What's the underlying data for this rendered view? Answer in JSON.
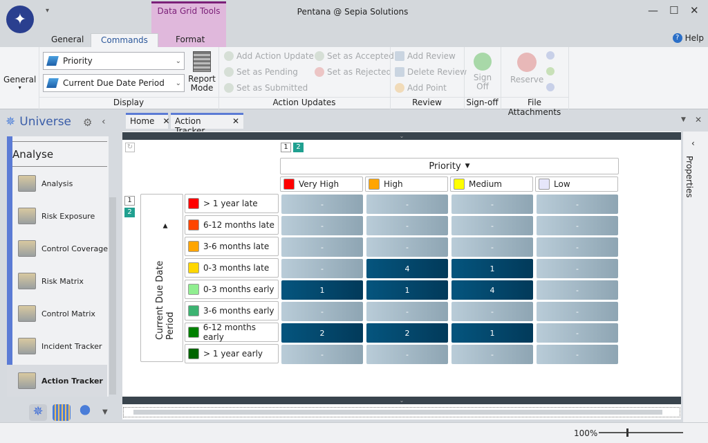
{
  "window": {
    "title": "Pentana @ Sepia Solutions",
    "context_tab_group": "Data Grid Tools",
    "minimize": "—",
    "maximize": "☐",
    "close": "✕"
  },
  "ribbon_tabs": [
    "General",
    "Commands",
    "Format"
  ],
  "help": "Help",
  "ribbon": {
    "general": "General",
    "display": {
      "combo1": "Priority",
      "combo2": "Current Due Date Period",
      "report_mode": "Report Mode",
      "label": "Display"
    },
    "action_updates": {
      "items": [
        "Add Action Update",
        "Set as Pending",
        "Set as Submitted",
        "Set as Accepted",
        "Set as Rejected"
      ],
      "label": "Action Updates"
    },
    "review": {
      "items": [
        "Add Review",
        "Delete Review",
        "Add Point"
      ],
      "label": "Review"
    },
    "signoff": {
      "button": "Sign Off",
      "label": "Sign-off"
    },
    "attachments": {
      "button": "Reserve",
      "label": "File Attachments"
    }
  },
  "sidebar": {
    "title": "Universe",
    "section": "Analyse",
    "items": [
      "Analysis",
      "Risk Exposure",
      "Control Coverage",
      "Risk Matrix",
      "Control Matrix",
      "Incident Tracker",
      "Action Tracker"
    ],
    "active": "Action Tracker"
  },
  "doc_tabs": [
    "Home",
    "Action Tracker"
  ],
  "properties": "Properties",
  "grid": {
    "levels": [
      "1",
      "2"
    ],
    "column_header": "Priority",
    "row_header": "Current Due Date Period",
    "columns": [
      {
        "label": "Very High",
        "color": "#ff0000"
      },
      {
        "label": "High",
        "color": "#ffa500"
      },
      {
        "label": "Medium",
        "color": "#ffff00"
      },
      {
        "label": "Low",
        "color": "#e6e6fa"
      }
    ],
    "rows": [
      {
        "label": "> 1 year late",
        "color": "#ff0000",
        "values": [
          "-",
          "-",
          "-",
          "-"
        ]
      },
      {
        "label": "6-12 months late",
        "color": "#ff4500",
        "values": [
          "-",
          "-",
          "-",
          "-"
        ]
      },
      {
        "label": "3-6 months late",
        "color": "#ffa500",
        "values": [
          "-",
          "-",
          "-",
          "-"
        ]
      },
      {
        "label": "0-3 months late",
        "color": "#ffd700",
        "values": [
          "-",
          "4",
          "1",
          "-"
        ]
      },
      {
        "label": "0-3 months early",
        "color": "#90ee90",
        "values": [
          "1",
          "1",
          "4",
          "-"
        ]
      },
      {
        "label": "3-6 months early",
        "color": "#3cb371",
        "values": [
          "-",
          "-",
          "-",
          "-"
        ]
      },
      {
        "label": "6-12 months early",
        "color": "#008000",
        "values": [
          "2",
          "2",
          "1",
          "-"
        ]
      },
      {
        "label": "> 1 year early",
        "color": "#006400",
        "values": [
          "-",
          "-",
          "-",
          "-"
        ]
      }
    ]
  },
  "status": {
    "zoom": "100%",
    "zoom_level": 100
  }
}
